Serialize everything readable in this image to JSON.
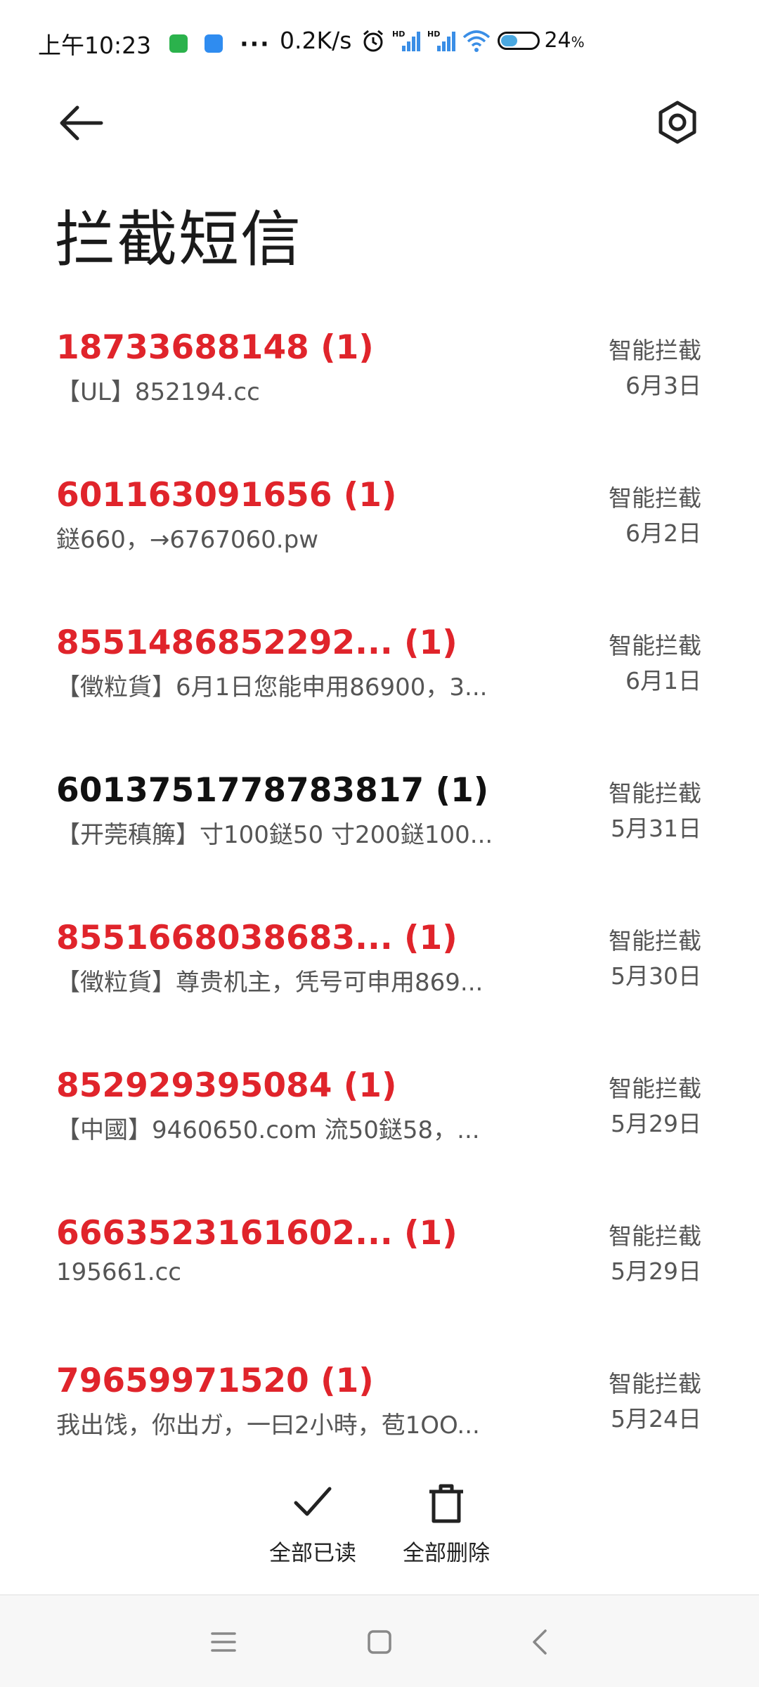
{
  "status_bar": {
    "time": "上午10:23",
    "dots": "···",
    "net_speed": "0.2K/s",
    "signal1_label": "HD",
    "signal2_label": "HD",
    "battery_level": 24,
    "battery_text": "24",
    "battery_unit": "%"
  },
  "header": {
    "title": "拦截短信"
  },
  "messages": [
    {
      "sender": "18733688148 (1)",
      "preview": "【UL】852194.cc",
      "tag": "智能拦截",
      "date": "6月3日",
      "highlight": true
    },
    {
      "sender": "601163091656 (1)",
      "preview": "鎹660，→6767060.pw",
      "tag": "智能拦截",
      "date": "6月2日",
      "highlight": true
    },
    {
      "sender": "8551486852292... (1)",
      "preview": "【徵粒貨】6月1日您能申用86900，3...",
      "tag": "智能拦截",
      "date": "6月1日",
      "highlight": true
    },
    {
      "sender": "6013751778783817 (1)",
      "preview": "【开莞稹簲】寸100鎹50 寸200鎹100...",
      "tag": "智能拦截",
      "date": "5月31日",
      "highlight": false
    },
    {
      "sender": "8551668038683... (1)",
      "preview": "【徵粒貨】尊贵机主，凭号可申用869...",
      "tag": "智能拦截",
      "date": "5月30日",
      "highlight": true
    },
    {
      "sender": "852929395084 (1)",
      "preview": "【中國】9460650.com 流50鎹58，...",
      "tag": "智能拦截",
      "date": "5月29日",
      "highlight": true
    },
    {
      "sender": "6663523161602... (1)",
      "preview": "195661.cc",
      "tag": "智能拦截",
      "date": "5月29日",
      "highlight": true
    },
    {
      "sender": "79659971520 (1)",
      "preview": "我出饯，你出ガ，一曰2小時，苞1OO...",
      "tag": "智能拦截",
      "date": "5月24日",
      "highlight": true
    }
  ],
  "actions": {
    "mark_all_read": "全部已读",
    "delete_all": "全部删除"
  },
  "icons": {
    "back": "back-arrow-icon",
    "settings": "settings-hex-icon",
    "mark_read": "check-icon",
    "delete": "trash-icon",
    "nav_menu": "menu-icon",
    "nav_home": "home-square-icon",
    "nav_back": "chevron-left-icon"
  },
  "colors": {
    "highlight": "#e0242b",
    "normal_sender": "#111111",
    "preview": "#555555"
  }
}
